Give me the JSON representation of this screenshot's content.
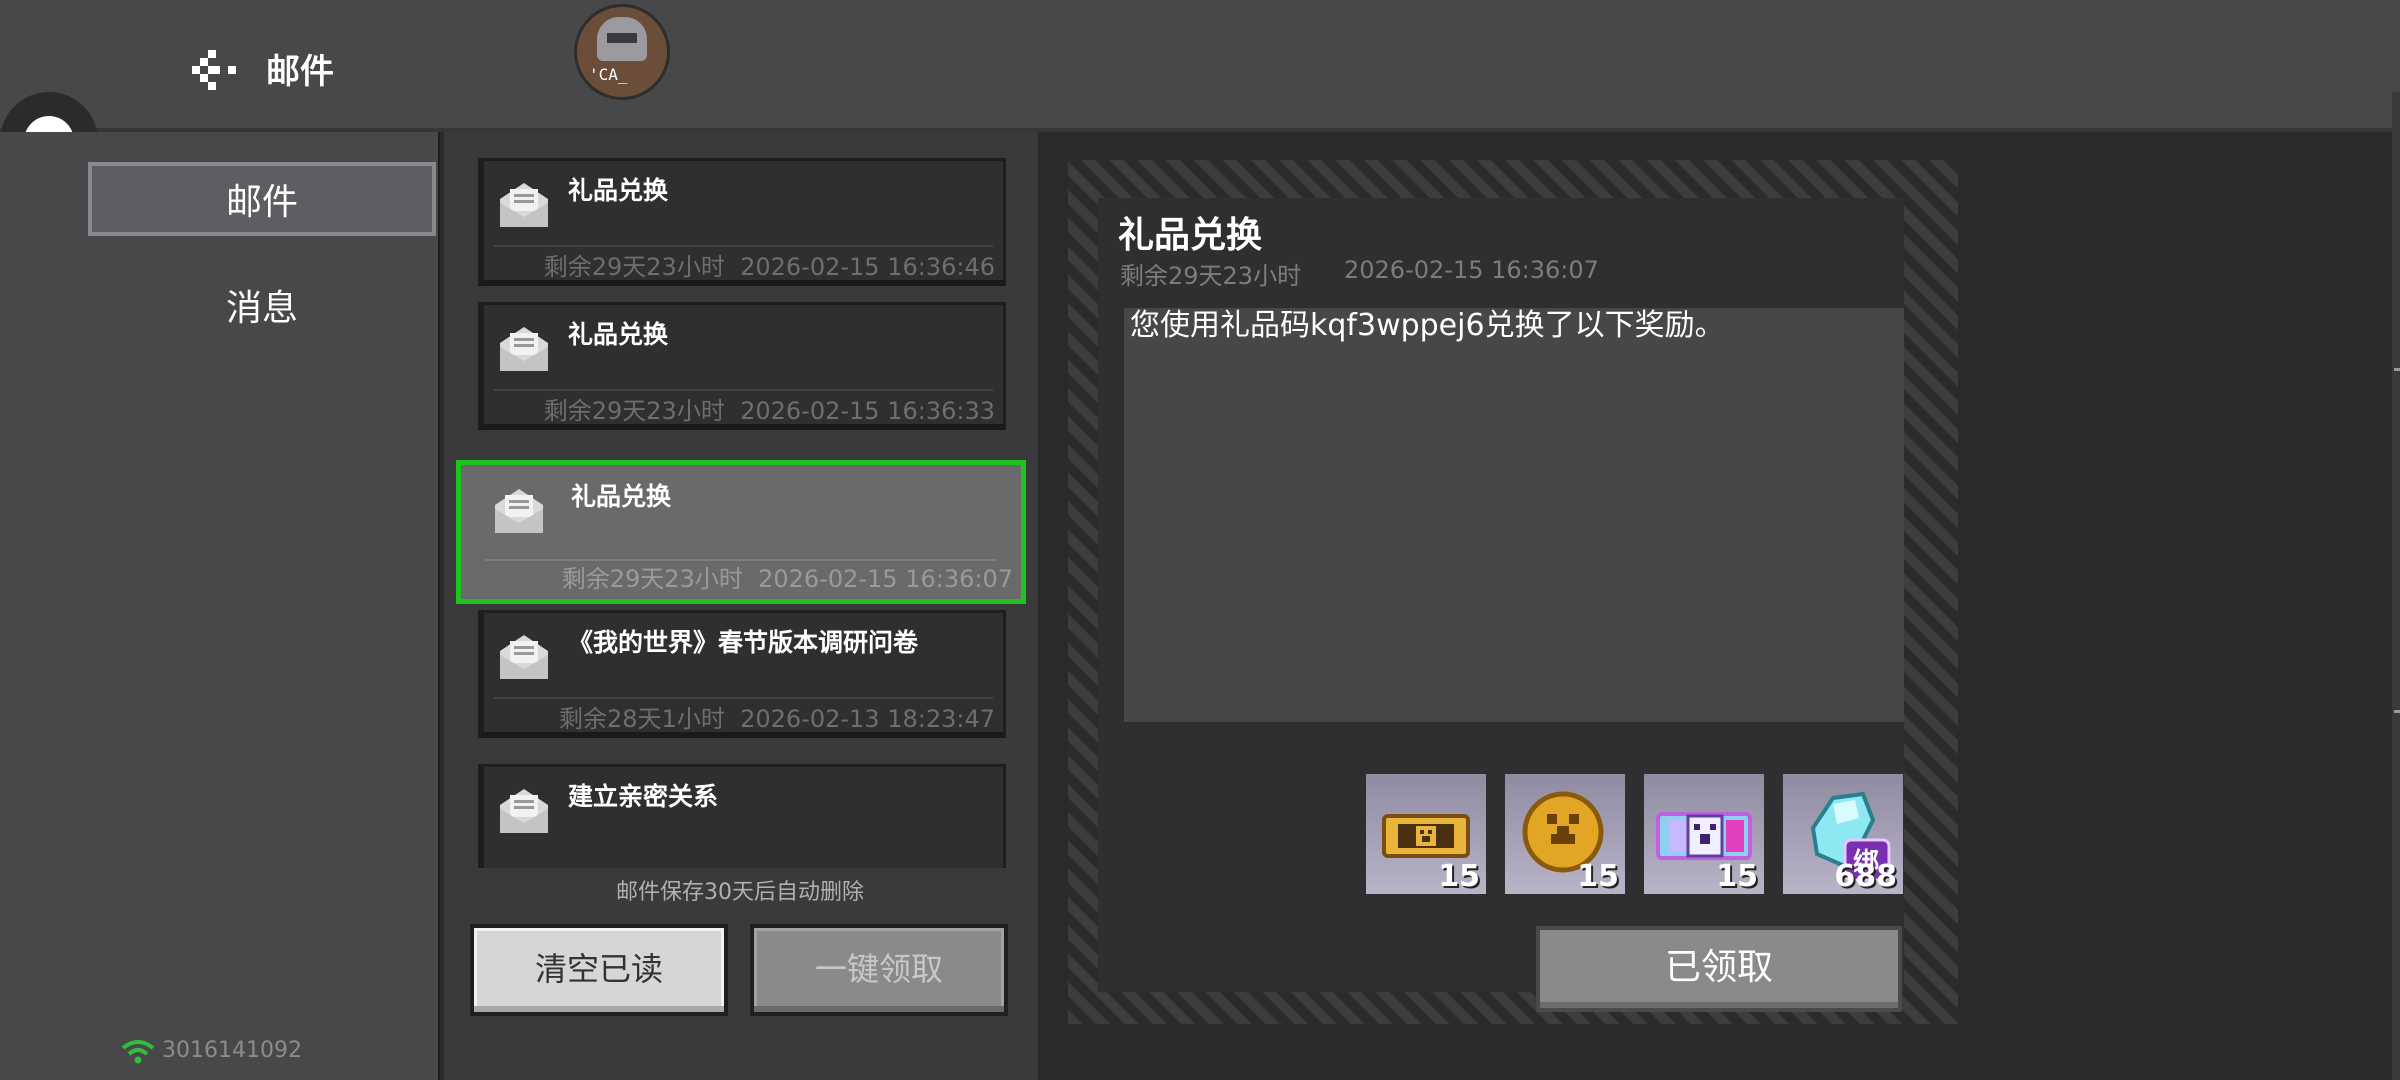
{
  "header": {
    "title": "邮件",
    "avatar_text": "'CA_"
  },
  "sidebar": {
    "tabs": [
      {
        "label": "邮件"
      },
      {
        "label": "消息"
      }
    ],
    "net_id": "3016141092"
  },
  "mail_list": {
    "items": [
      {
        "subject": "礼品兑换",
        "remaining": "剩余29天23小时",
        "date": "2026-02-15 16:36:46"
      },
      {
        "subject": "礼品兑换",
        "remaining": "剩余29天23小时",
        "date": "2026-02-15 16:36:33"
      },
      {
        "subject": "礼品兑换",
        "remaining": "剩余29天23小时",
        "date": "2026-02-15 16:36:07"
      },
      {
        "subject": "《我的世界》春节版本调研问卷",
        "remaining": "剩余28天1小时",
        "date": "2026-02-13 18:23:47"
      },
      {
        "subject": "建立亲密关系"
      }
    ],
    "notice": "邮件保存30天后自动删除",
    "clear_read_label": "清空已读",
    "claim_all_label": "一键领取"
  },
  "detail": {
    "title": "礼品兑换",
    "remaining": "剩余29天23小时",
    "date": "2026-02-15 16:36:07",
    "body": "您使用礼品码kqf3wppej6兑换了以下奖励。",
    "rewards": [
      {
        "icon": "gold-ticket-icon",
        "qty": "15"
      },
      {
        "icon": "gold-coin-icon",
        "qty": "15"
      },
      {
        "icon": "rainbow-ticket-icon",
        "qty": "15"
      },
      {
        "icon": "diamond-icon",
        "qty": "688",
        "badge": "绑"
      }
    ],
    "received_label": "已领取"
  },
  "colors": {
    "selected_border": "#1ec41e",
    "panel": "#48484a"
  }
}
